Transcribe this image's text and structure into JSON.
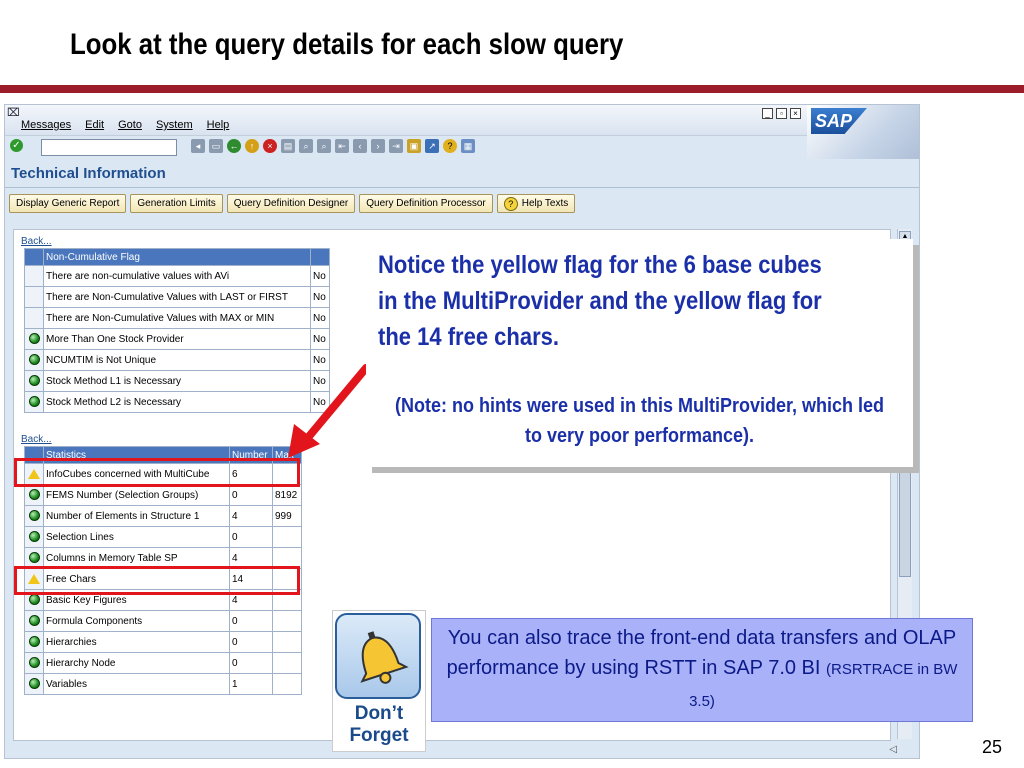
{
  "slide": {
    "title": "Look at the query details for each slow query",
    "page_number": "25",
    "accent_color": "#9c1d29"
  },
  "sap_window": {
    "menu_glyph": "⌧",
    "menu": [
      "Messages",
      "Edit",
      "Goto",
      "System",
      "Help"
    ],
    "window_controls": [
      "minimize-icon",
      "maximize-icon",
      "close-icon"
    ],
    "logo_text": "SAP",
    "toolbar_icons": [
      "enter-icon",
      "back-icon",
      "exit-icon",
      "cancel-icon",
      "print-icon",
      "find-icon",
      "find-next-icon",
      "first-page-icon",
      "prev-page-icon",
      "next-page-icon",
      "last-page-icon",
      "create-session-icon",
      "shortcut-icon",
      "help-icon",
      "layout-icon"
    ],
    "screen_title": "Technical Information",
    "app_buttons": [
      "Display Generic Report",
      "Generation Limits",
      "Query Definition Designer",
      "Query Definition Processor",
      "Help Texts"
    ],
    "back_link_1": "Back...",
    "back_link_2": "Back...",
    "table1": {
      "headers": [
        "Non-Cumulative Flag",
        ""
      ],
      "rows": [
        {
          "status": "none",
          "label": "There are non-cumulative values with AVi",
          "value": "No"
        },
        {
          "status": "none",
          "label": "There are Non-Cumulative Values with LAST or FIRST",
          "value": "No"
        },
        {
          "status": "none",
          "label": "There are Non-Cumulative Values with MAX or MIN",
          "value": "No"
        },
        {
          "status": "green",
          "label": "More Than One Stock Provider",
          "value": "No"
        },
        {
          "status": "green",
          "label": "NCUMTIM is Not Unique",
          "value": "No"
        },
        {
          "status": "green",
          "label": "Stock Method L1 is Necessary",
          "value": "No"
        },
        {
          "status": "green",
          "label": "Stock Method L2 is Necessary",
          "value": "No"
        }
      ]
    },
    "table2": {
      "headers": [
        "Statistics",
        "Number",
        "Max"
      ],
      "rows": [
        {
          "status": "yellow",
          "label": "InfoCubes concerned with MultiCube",
          "number": "6",
          "max": ""
        },
        {
          "status": "green",
          "label": "FEMS Number (Selection Groups)",
          "number": "0",
          "max": "8192"
        },
        {
          "status": "green",
          "label": "Number of Elements in Structure 1",
          "number": "4",
          "max": "999"
        },
        {
          "status": "green",
          "label": "Selection Lines",
          "number": "0",
          "max": ""
        },
        {
          "status": "green",
          "label": "Columns in Memory Table SP",
          "number": "4",
          "max": ""
        },
        {
          "status": "yellow",
          "label": "Free Chars",
          "number": "14",
          "max": ""
        },
        {
          "status": "green",
          "label": "Basic Key Figures",
          "number": "4",
          "max": ""
        },
        {
          "status": "green",
          "label": "Formula Components",
          "number": "0",
          "max": ""
        },
        {
          "status": "green",
          "label": "Hierarchies",
          "number": "0",
          "max": ""
        },
        {
          "status": "green",
          "label": "Hierarchy Node",
          "number": "0",
          "max": ""
        },
        {
          "status": "green",
          "label": "Variables",
          "number": "1",
          "max": ""
        }
      ]
    }
  },
  "callout": {
    "main": "Notice the yellow flag for the 6 base cubes in the MultiProvider and the yellow flag for the 14 free chars.",
    "note": "(Note: no hints were used in this MultiProvider, which led to very poor performance)."
  },
  "dont_forget": {
    "icon": "bell-icon",
    "line1": "Don’t",
    "line2": "Forget"
  },
  "tip": {
    "text": "You can also trace the front-end data transfers and OLAP performance by using RSTT in SAP 7.0 BI",
    "small": "(RSRTRACE in BW 3.5)"
  },
  "colors": {
    "highlight_red": "#e2141c",
    "callout_blue": "#1a2fa8",
    "tip_bg": "#a9b1f8"
  }
}
